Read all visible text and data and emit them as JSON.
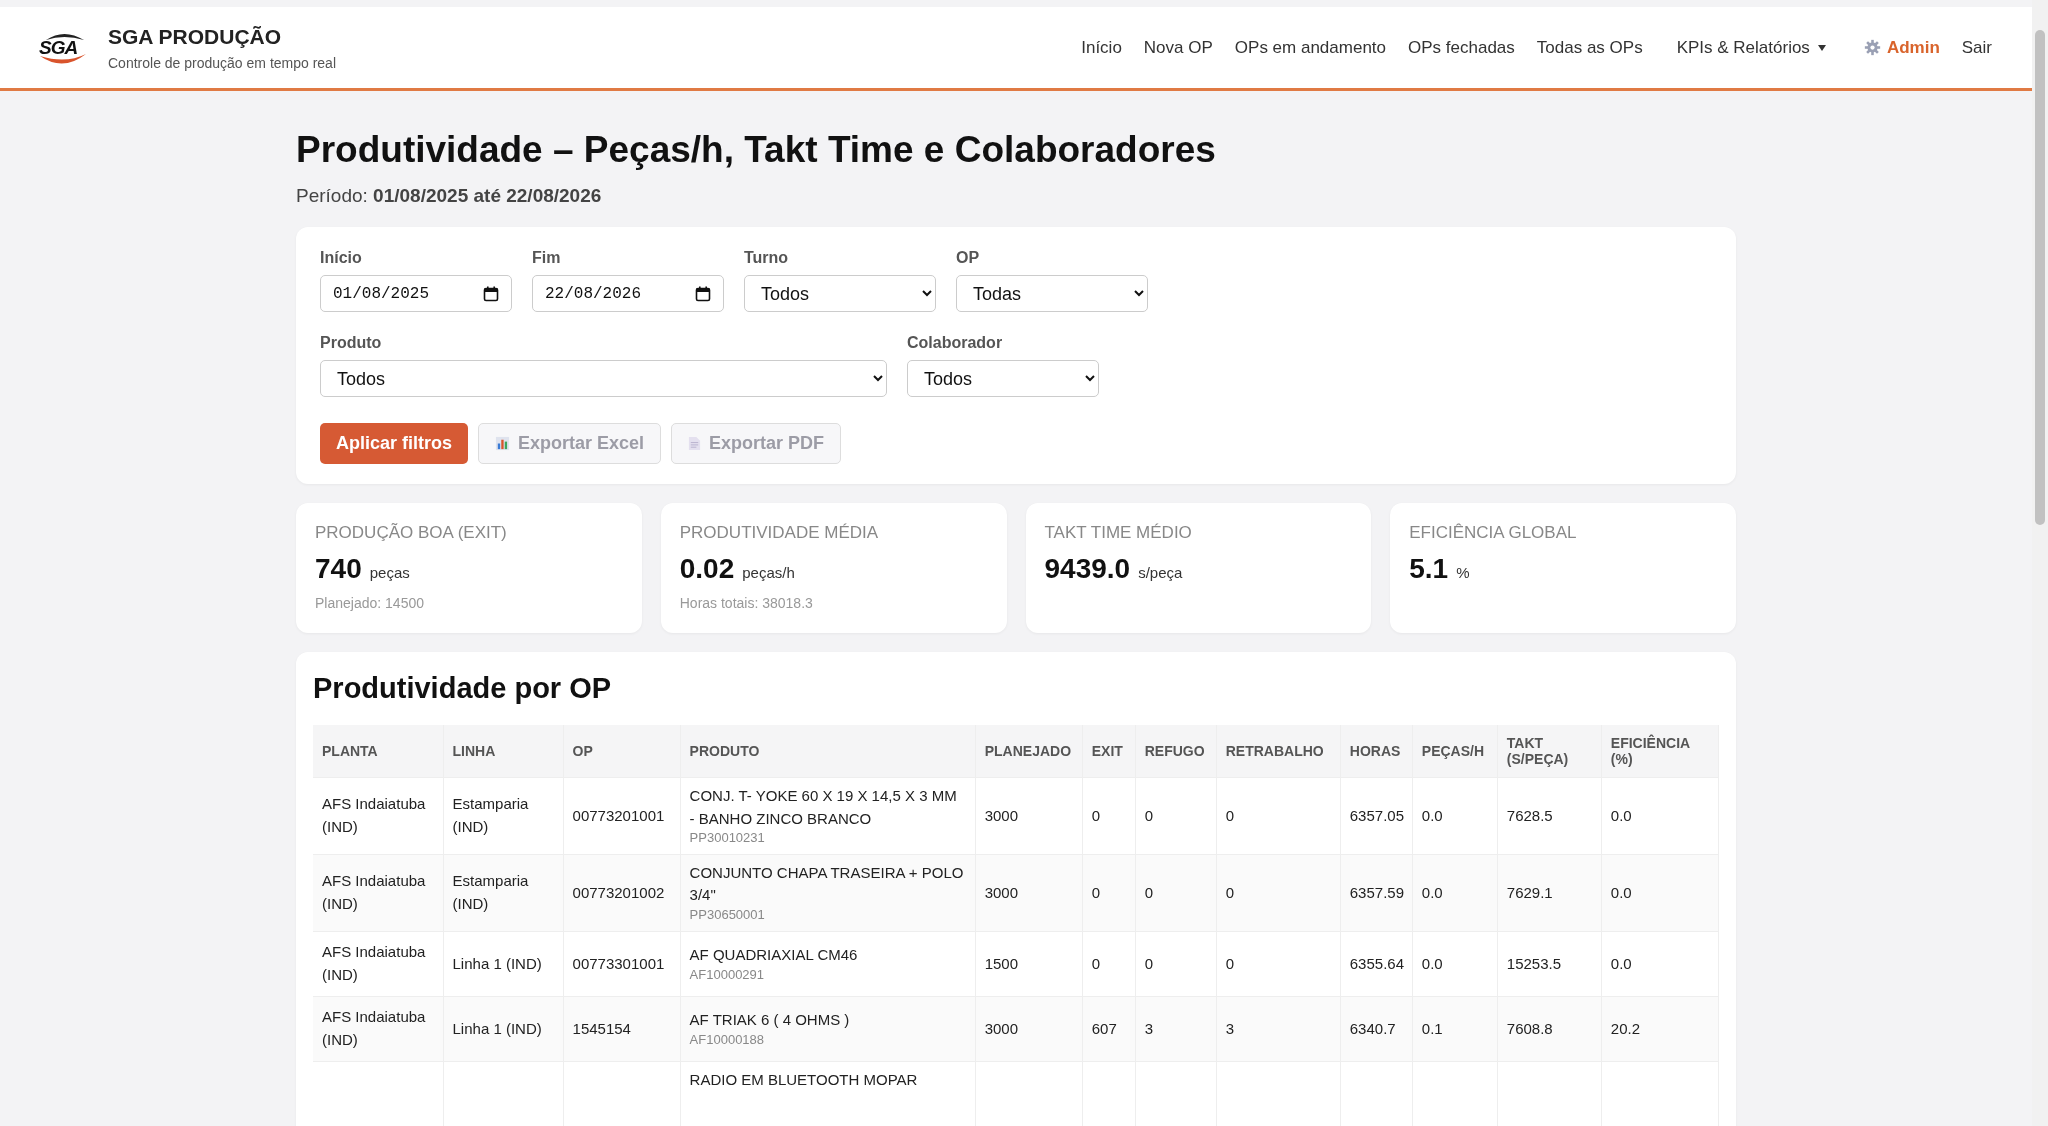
{
  "header": {
    "logo_text": "SGA",
    "app_name": "SGA PRODUÇÃO",
    "tagline": "Controle de produção em tempo real",
    "nav": [
      {
        "label": "Início",
        "kind": "link"
      },
      {
        "label": "Nova OP",
        "kind": "link"
      },
      {
        "label": "OPs em andamento",
        "kind": "link"
      },
      {
        "label": "OPs fechadas",
        "kind": "link"
      },
      {
        "label": "Todas as OPs",
        "kind": "link"
      },
      {
        "label": "KPIs & Relatórios",
        "kind": "dropdown"
      },
      {
        "label": "Admin",
        "kind": "admin"
      },
      {
        "label": "Sair",
        "kind": "link"
      }
    ]
  },
  "page": {
    "title": "Produtividade – Peças/h, Takt Time e Colaboradores",
    "period_label": "Período:",
    "period_value": "01/08/2025 até 22/08/2026"
  },
  "filters": {
    "fields": [
      {
        "label": "Início",
        "kind": "date",
        "value": "01/08/2025"
      },
      {
        "label": "Fim",
        "kind": "date",
        "value": "22/08/2026"
      },
      {
        "label": "Turno",
        "kind": "select",
        "value": "Todos"
      },
      {
        "label": "OP",
        "kind": "select",
        "value": "Todas"
      }
    ],
    "fields_row2": [
      {
        "label": "Produto",
        "kind": "select",
        "value": "Todos"
      },
      {
        "label": "Colaborador",
        "kind": "select",
        "value": "Todos"
      }
    ],
    "buttons": [
      {
        "label": "Aplicar filtros",
        "kind": "primary",
        "disabled": false
      },
      {
        "label": "Exportar Excel",
        "kind": "excel",
        "disabled": true
      },
      {
        "label": "Exportar PDF",
        "kind": "pdf",
        "disabled": true
      }
    ]
  },
  "kpis": [
    {
      "title": "PRODUÇÃO BOA (EXIT)",
      "value": "740",
      "unit": "peças",
      "note": "Planejado: 14500"
    },
    {
      "title": "PRODUTIVIDADE MÉDIA",
      "value": "0.02",
      "unit": "peças/h",
      "note": "Horas totais: 38018.3"
    },
    {
      "title": "TAKT TIME MÉDIO",
      "value": "9439.0",
      "unit": "s/peça"
    },
    {
      "title": "EFICIÊNCIA GLOBAL",
      "value": "5.1",
      "unit": "%"
    }
  ],
  "table": {
    "title": "Produtividade por OP",
    "columns": [
      "PLANTA",
      "LINHA",
      "OP",
      "PRODUTO",
      "PLANEJADO",
      "EXIT",
      "REFUGO",
      "RETRABALHO",
      "HORAS",
      "PEÇAS/H",
      "TAKT (S/PEÇA)",
      "EFICIÊNCIA (%)"
    ],
    "rows": [
      {
        "planta": "AFS Indaiatuba (IND)",
        "linha": "Estamparia (IND)",
        "op": "00773201001",
        "produto": "CONJ. T- YOKE 60 X 19 X 14,5 X 3 MM - BANHO ZINCO BRANCO",
        "codigo": "PP30010231",
        "planejado": "3000",
        "exit": "0",
        "refugo": "0",
        "retrabalho": "0",
        "horas": "6357.05",
        "pecas_h": "0.0",
        "takt": "7628.5",
        "eficiencia": "0.0"
      },
      {
        "planta": "AFS Indaiatuba (IND)",
        "linha": "Estamparia (IND)",
        "op": "00773201002",
        "produto": "CONJUNTO CHAPA TRASEIRA + POLO 3/4\"",
        "codigo": "PP30650001",
        "planejado": "3000",
        "exit": "0",
        "refugo": "0",
        "retrabalho": "0",
        "horas": "6357.59",
        "pecas_h": "0.0",
        "takt": "7629.1",
        "eficiencia": "0.0"
      },
      {
        "planta": "AFS Indaiatuba (IND)",
        "linha": "Linha 1 (IND)",
        "op": "00773301001",
        "produto": "AF QUADRIAXIAL CM46",
        "codigo": "AF10000291",
        "planejado": "1500",
        "exit": "0",
        "refugo": "0",
        "retrabalho": "0",
        "horas": "6355.64",
        "pecas_h": "0.0",
        "takt": "15253.5",
        "eficiencia": "0.0"
      },
      {
        "planta": "AFS Indaiatuba (IND)",
        "linha": "Linha 1 (IND)",
        "op": "1545154",
        "produto": "AF TRIAK 6 ( 4 OHMS )",
        "codigo": "AF10000188",
        "planejado": "3000",
        "exit": "607",
        "refugo": "3",
        "retrabalho": "3",
        "horas": "6340.7",
        "pecas_h": "0.1",
        "takt": "7608.8",
        "eficiencia": "20.2"
      },
      {
        "produto": "RADIO EM BLUETOOTH MOPAR"
      }
    ]
  }
}
